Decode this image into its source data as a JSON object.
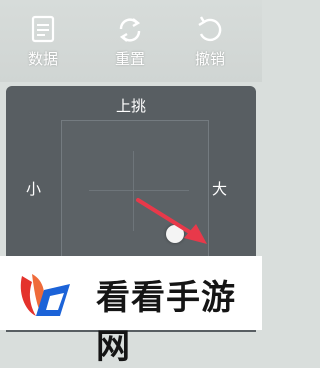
{
  "toolbar": {
    "data_label": "数据",
    "reset_label": "重置",
    "undo_label": "撤销"
  },
  "panel": {
    "title": "上挑",
    "left_label": "小",
    "right_label": "大"
  },
  "brand": {
    "text": "看看手游网"
  },
  "colors": {
    "arrow": "#e8394a",
    "panel": "#585e62",
    "brand_red": "#e4322c",
    "brand_blue": "#1c63d8"
  }
}
